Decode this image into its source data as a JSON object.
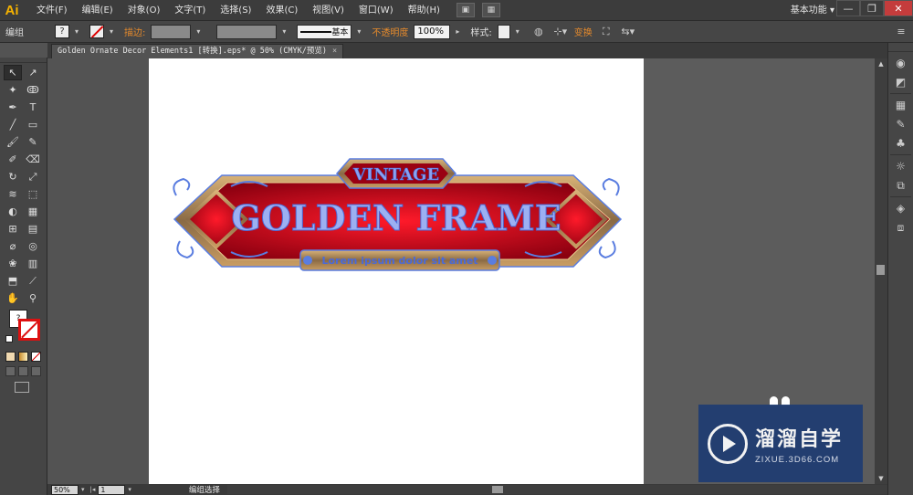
{
  "app": {
    "logo": "Ai",
    "workspace": "基本功能 ▾"
  },
  "menu": [
    "文件(F)",
    "编辑(E)",
    "对象(O)",
    "文字(T)",
    "选择(S)",
    "效果(C)",
    "视图(V)",
    "窗口(W)",
    "帮助(H)"
  ],
  "window_controls": {
    "minimize": "—",
    "restore": "❐",
    "close": "✕"
  },
  "controlbar": {
    "selection_label": "编组",
    "stroke_label": "描边:",
    "stroke_style": "基本",
    "opacity_label": "不透明度",
    "opacity_value": "100%",
    "style_label": "样式:",
    "transform_label": "变换"
  },
  "document_tab": {
    "title": "Golden Ornate Decor Elements1 [转换].eps* @ 50% (CMYK/预览)",
    "close": "×"
  },
  "tools": [
    {
      "name": "selection-tool",
      "glyph": "↖"
    },
    {
      "name": "direct-selection-tool",
      "glyph": "↗"
    },
    {
      "name": "magic-wand-tool",
      "glyph": "✦"
    },
    {
      "name": "lasso-tool",
      "glyph": "ↂ"
    },
    {
      "name": "pen-tool",
      "glyph": "✒"
    },
    {
      "name": "type-tool",
      "glyph": "T"
    },
    {
      "name": "line-tool",
      "glyph": "╱"
    },
    {
      "name": "rectangle-tool",
      "glyph": "▭"
    },
    {
      "name": "paintbrush-tool",
      "glyph": "🖌"
    },
    {
      "name": "pencil-tool",
      "glyph": "✎"
    },
    {
      "name": "blob-brush-tool",
      "glyph": "✐"
    },
    {
      "name": "eraser-tool",
      "glyph": "⌫"
    },
    {
      "name": "rotate-tool",
      "glyph": "↻"
    },
    {
      "name": "scale-tool",
      "glyph": "⤢"
    },
    {
      "name": "width-tool",
      "glyph": "≋"
    },
    {
      "name": "free-transform-tool",
      "glyph": "⬚"
    },
    {
      "name": "shape-builder-tool",
      "glyph": "◐"
    },
    {
      "name": "perspective-grid-tool",
      "glyph": "▦"
    },
    {
      "name": "mesh-tool",
      "glyph": "⊞"
    },
    {
      "name": "gradient-tool",
      "glyph": "▤"
    },
    {
      "name": "eyedropper-tool",
      "glyph": "⌀"
    },
    {
      "name": "blend-tool",
      "glyph": "◎"
    },
    {
      "name": "symbol-sprayer-tool",
      "glyph": "❀"
    },
    {
      "name": "column-graph-tool",
      "glyph": "▥"
    },
    {
      "name": "artboard-tool",
      "glyph": "⬒"
    },
    {
      "name": "slice-tool",
      "glyph": "⟋"
    },
    {
      "name": "hand-tool",
      "glyph": "✋"
    },
    {
      "name": "zoom-tool",
      "glyph": "⚲"
    }
  ],
  "fill_stroke": {
    "fill_glyph": "?"
  },
  "artwork": {
    "top_badge": "VINTAGE",
    "main_title": "GOLDEN FRAME",
    "ribbon": "Lorem ipsum dolor sit amet"
  },
  "statusbar": {
    "zoom": "50%",
    "artboard_num": "1",
    "status_text": "编组选择"
  },
  "watermark": {
    "title": "溜溜自学",
    "url": "ZIXUE.3D66.COM"
  },
  "colors": {
    "accent_orange": "#e58a2c",
    "frame_red": "#c8001a",
    "frame_gold": "#b08a50",
    "selection_blue": "#5a7de0"
  }
}
